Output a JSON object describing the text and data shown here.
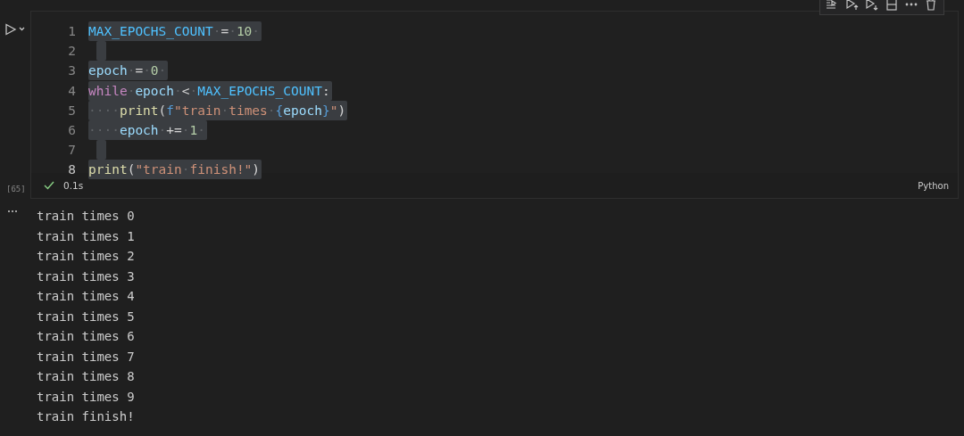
{
  "cell": {
    "execution_count": "[65]",
    "succeeded": true,
    "duration": "0.1s",
    "language": "Python",
    "lines": [
      {
        "number": "1",
        "tokens": [
          {
            "text": "MAX_EPOCHS_COUNT",
            "kind": "const"
          },
          {
            "text": "·",
            "kind": "ws"
          },
          {
            "text": "=",
            "kind": "op"
          },
          {
            "text": "·",
            "kind": "ws"
          },
          {
            "text": "10",
            "kind": "num"
          },
          {
            "text": "·",
            "kind": "ws"
          }
        ]
      },
      {
        "number": "2"
      },
      {
        "number": "3",
        "tokens": [
          {
            "text": "epoch",
            "kind": "var"
          },
          {
            "text": "·",
            "kind": "ws"
          },
          {
            "text": "=",
            "kind": "op"
          },
          {
            "text": "·",
            "kind": "ws"
          },
          {
            "text": "0",
            "kind": "num"
          },
          {
            "text": "·",
            "kind": "ws"
          }
        ]
      },
      {
        "number": "4",
        "tokens": [
          {
            "text": "while",
            "kind": "kw"
          },
          {
            "text": "·",
            "kind": "ws"
          },
          {
            "text": "epoch",
            "kind": "var"
          },
          {
            "text": "·",
            "kind": "ws"
          },
          {
            "text": "<",
            "kind": "op"
          },
          {
            "text": "·",
            "kind": "ws"
          },
          {
            "text": "MAX_EPOCHS_COUNT",
            "kind": "const"
          },
          {
            "text": ":",
            "kind": "op"
          }
        ]
      },
      {
        "number": "5",
        "tokens": [
          {
            "text": "····",
            "kind": "ws"
          },
          {
            "text": "print",
            "kind": "fn"
          },
          {
            "text": "(",
            "kind": "op"
          },
          {
            "text": "f",
            "kind": "prefix"
          },
          {
            "text": "\"train",
            "kind": "str"
          },
          {
            "text": "·",
            "kind": "ws"
          },
          {
            "text": "times",
            "kind": "str"
          },
          {
            "text": "·",
            "kind": "ws"
          },
          {
            "text": "{",
            "kind": "brace"
          },
          {
            "text": "epoch",
            "kind": "var"
          },
          {
            "text": "}",
            "kind": "brace"
          },
          {
            "text": "\"",
            "kind": "str"
          },
          {
            "text": ")",
            "kind": "op"
          }
        ]
      },
      {
        "number": "6",
        "tokens": [
          {
            "text": "····",
            "kind": "ws"
          },
          {
            "text": "epoch",
            "kind": "var"
          },
          {
            "text": "·",
            "kind": "ws"
          },
          {
            "text": "+=",
            "kind": "op"
          },
          {
            "text": "·",
            "kind": "ws"
          },
          {
            "text": "1",
            "kind": "num"
          },
          {
            "text": "·",
            "kind": "ws"
          }
        ]
      },
      {
        "number": "7"
      },
      {
        "number": "8",
        "tokens": [
          {
            "text": "print",
            "kind": "fn"
          },
          {
            "text": "(",
            "kind": "op"
          },
          {
            "text": "\"train",
            "kind": "str"
          },
          {
            "text": "·",
            "kind": "ws"
          },
          {
            "text": "finish!\"",
            "kind": "str"
          },
          {
            "text": ")",
            "kind": "op"
          }
        ]
      }
    ]
  },
  "output": [
    "train times 0",
    "train times 1",
    "train times 2",
    "train times 3",
    "train times 4",
    "train times 5",
    "train times 6",
    "train times 7",
    "train times 8",
    "train times 9",
    "train finish!"
  ]
}
